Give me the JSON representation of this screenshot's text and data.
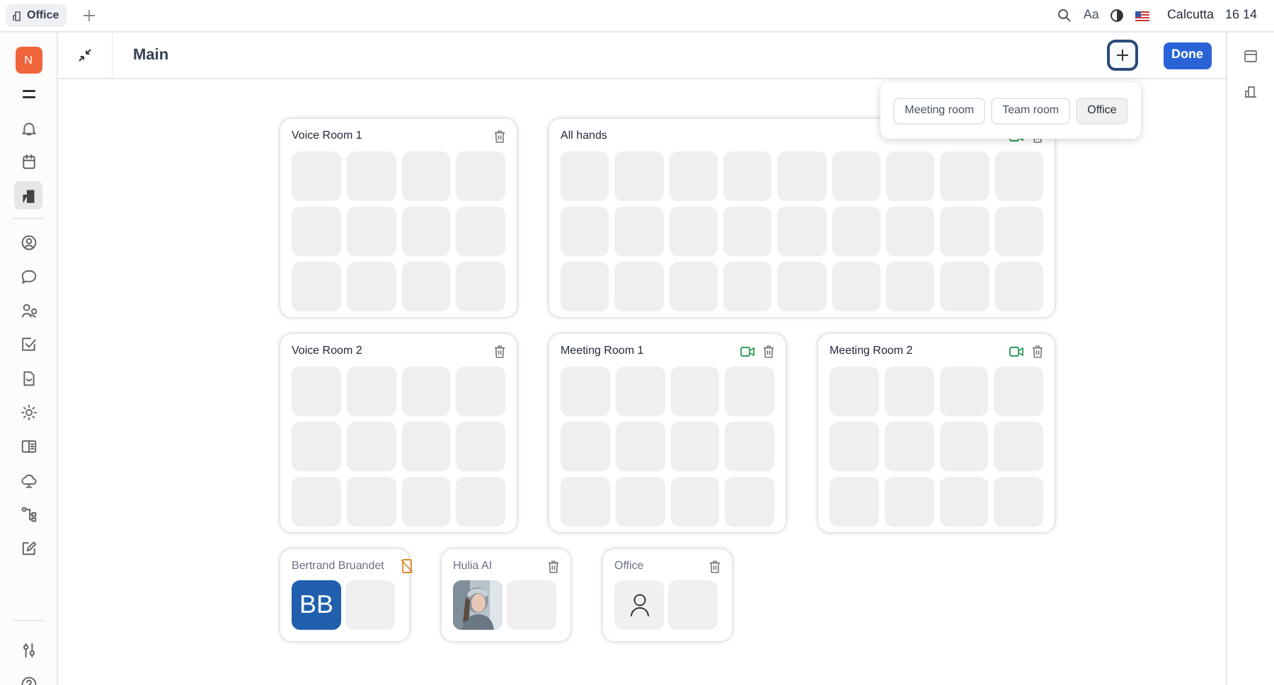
{
  "tabs": [
    {
      "label": "Office",
      "selected": true
    }
  ],
  "top_bar": {
    "font_label": "Aa",
    "city": "Calcutta",
    "time": "16 14"
  },
  "user": {
    "initial": "N"
  },
  "sidebar": {
    "items": [
      {
        "selected": false
      },
      {
        "selected": false
      },
      {
        "selected": false
      },
      {
        "selected": true
      },
      {
        "selected": false
      },
      {
        "selected": false
      },
      {
        "selected": false
      },
      {
        "selected": false
      },
      {
        "selected": false
      },
      {
        "selected": false
      },
      {
        "selected": false
      },
      {
        "selected": false
      },
      {
        "selected": false
      },
      {
        "selected": false
      },
      {
        "selected": false
      },
      {
        "selected": false
      }
    ]
  },
  "header": {
    "title": "Main",
    "done": "Done"
  },
  "add_menu": {
    "options": [
      {
        "label": "Meeting room",
        "selected": false
      },
      {
        "label": "Team room",
        "selected": false
      },
      {
        "label": "Office",
        "selected": true
      }
    ]
  },
  "rows": [
    {
      "cards": [
        {
          "kind": "room",
          "name": "Voice Room 1",
          "video": false,
          "removable": true
        },
        {
          "kind": "wide_room",
          "name": "All hands",
          "video": true,
          "removable": true
        }
      ]
    },
    {
      "cards": [
        {
          "kind": "room",
          "name": "Voice Room 2",
          "video": false,
          "removable": true
        },
        {
          "kind": "room",
          "name": "Meeting Room 1",
          "video": true,
          "removable": true
        },
        {
          "kind": "room",
          "name": "Meeting Room 2",
          "video": true,
          "removable": true
        }
      ]
    },
    {
      "cards": [
        {
          "kind": "person",
          "name": "Bertrand Bruandet",
          "removable": false,
          "avatar": {
            "kind": "initials",
            "text": "BB"
          }
        },
        {
          "kind": "person",
          "name": "Hulia AI",
          "removable": true
        },
        {
          "kind": "person",
          "name": "Office",
          "removable": true,
          "avatar": {
            "kind": "placeholder"
          }
        }
      ]
    }
  ]
}
